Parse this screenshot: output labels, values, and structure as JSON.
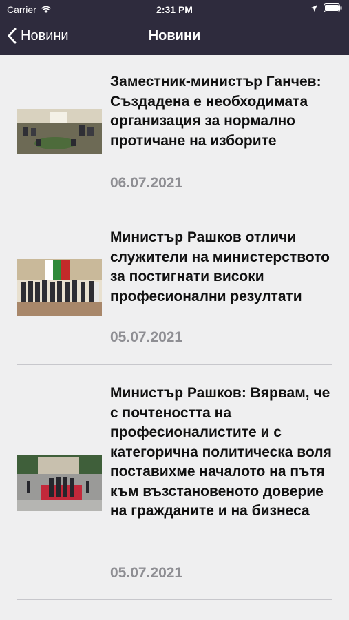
{
  "status_bar": {
    "carrier": "Carrier",
    "time": "2:31 PM"
  },
  "nav": {
    "back_label": "Новини",
    "title": "Новини"
  },
  "news": [
    {
      "title": "Заместник-министър Ганчев: Създадена е необходимата организация за нормално протичане на изборите",
      "date": "06.07.2021"
    },
    {
      "title": "Министър Рашков отличи служители на министерството за постигнати високи професионални резултати",
      "date": "05.07.2021"
    },
    {
      "title": "Министър Рашков: Вярвам, че с почтеността на професионалистите и с категорична политическа воля поставихме началото на пътя към възстановеното доверие на гражданите и на бизнеса",
      "date": "05.07.2021"
    }
  ],
  "colors": {
    "nav_bg": "#2e2b3d",
    "list_bg": "#efeff0",
    "date": "#8e8e93"
  }
}
